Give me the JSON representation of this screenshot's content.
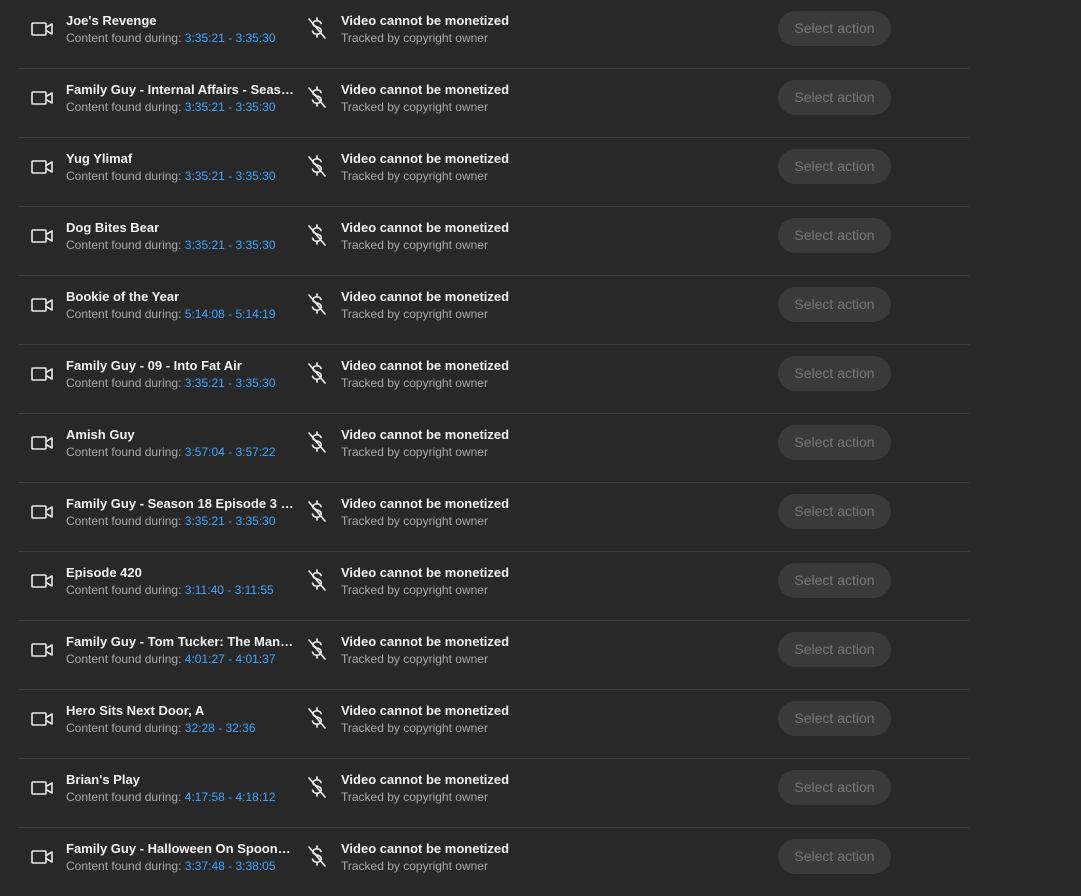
{
  "rows": [
    {
      "title": "Joe's Revenge",
      "found_label": "Content found during:",
      "range": "3:35:21 - 3:35:30",
      "status": "Video cannot be monetized",
      "tracked": "Tracked by copyright owner",
      "action": "Select action"
    },
    {
      "title": "Family Guy - Internal Affairs - Season ...",
      "found_label": "Content found during:",
      "range": "3:35:21 - 3:35:30",
      "status": "Video cannot be monetized",
      "tracked": "Tracked by copyright owner",
      "action": "Select action"
    },
    {
      "title": "Yug Ylimaf",
      "found_label": "Content found during:",
      "range": "3:35:21 - 3:35:30",
      "status": "Video cannot be monetized",
      "tracked": "Tracked by copyright owner",
      "action": "Select action"
    },
    {
      "title": "Dog Bites Bear",
      "found_label": "Content found during:",
      "range": "3:35:21 - 3:35:30",
      "status": "Video cannot be monetized",
      "tracked": "Tracked by copyright owner",
      "action": "Select action"
    },
    {
      "title": "Bookie of the Year",
      "found_label": "Content found during:",
      "range": "5:14:08 - 5:14:19",
      "status": "Video cannot be monetized",
      "tracked": "Tracked by copyright owner",
      "action": "Select action"
    },
    {
      "title": "Family Guy - 09 - Into Fat Air",
      "found_label": "Content found during:",
      "range": "3:35:21 - 3:35:30",
      "status": "Video cannot be monetized",
      "tracked": "Tracked by copyright owner",
      "action": "Select action"
    },
    {
      "title": "Amish Guy",
      "found_label": "Content found during:",
      "range": "3:57:04 - 3:57:22",
      "status": "Video cannot be monetized",
      "tracked": "Tracked by copyright owner",
      "action": "Select action"
    },
    {
      "title": "Family Guy - Season 18 Episode 3 (A...",
      "found_label": "Content found during:",
      "range": "3:35:21 - 3:35:30",
      "status": "Video cannot be monetized",
      "tracked": "Tracked by copyright owner",
      "action": "Select action"
    },
    {
      "title": "Episode 420",
      "found_label": "Content found during:",
      "range": "3:11:40 - 3:11:55",
      "status": "Video cannot be monetized",
      "tracked": "Tracked by copyright owner",
      "action": "Select action"
    },
    {
      "title": "Family Guy - Tom Tucker: The Man an...",
      "found_label": "Content found during:",
      "range": "4:01:27 - 4:01:37",
      "status": "Video cannot be monetized",
      "tracked": "Tracked by copyright owner",
      "action": "Select action"
    },
    {
      "title": "Hero Sits Next Door, A",
      "found_label": "Content found during:",
      "range": "32:28 - 32:36",
      "status": "Video cannot be monetized",
      "tracked": "Tracked by copyright owner",
      "action": "Select action"
    },
    {
      "title": "Brian's Play",
      "found_label": "Content found during:",
      "range": "4:17:58 - 4:18:12",
      "status": "Video cannot be monetized",
      "tracked": "Tracked by copyright owner",
      "action": "Select action"
    },
    {
      "title": "Family Guy - Halloween On Spooner S...",
      "found_label": "Content found during:",
      "range": "3:37:48 - 3:38:05",
      "status": "Video cannot be monetized",
      "tracked": "Tracked by copyright owner",
      "action": "Select action"
    }
  ],
  "icons": {
    "video": "video-camera-icon",
    "monetization": "monetization-off-icon"
  },
  "colors": {
    "background": "#282828",
    "title_text": "#f1f1f1",
    "secondary_text": "#aaaaaa",
    "time_range": "#3ea6ff",
    "button_bg": "#3a3a3a",
    "button_text": "#787878",
    "divider": "#3d3d3d"
  }
}
